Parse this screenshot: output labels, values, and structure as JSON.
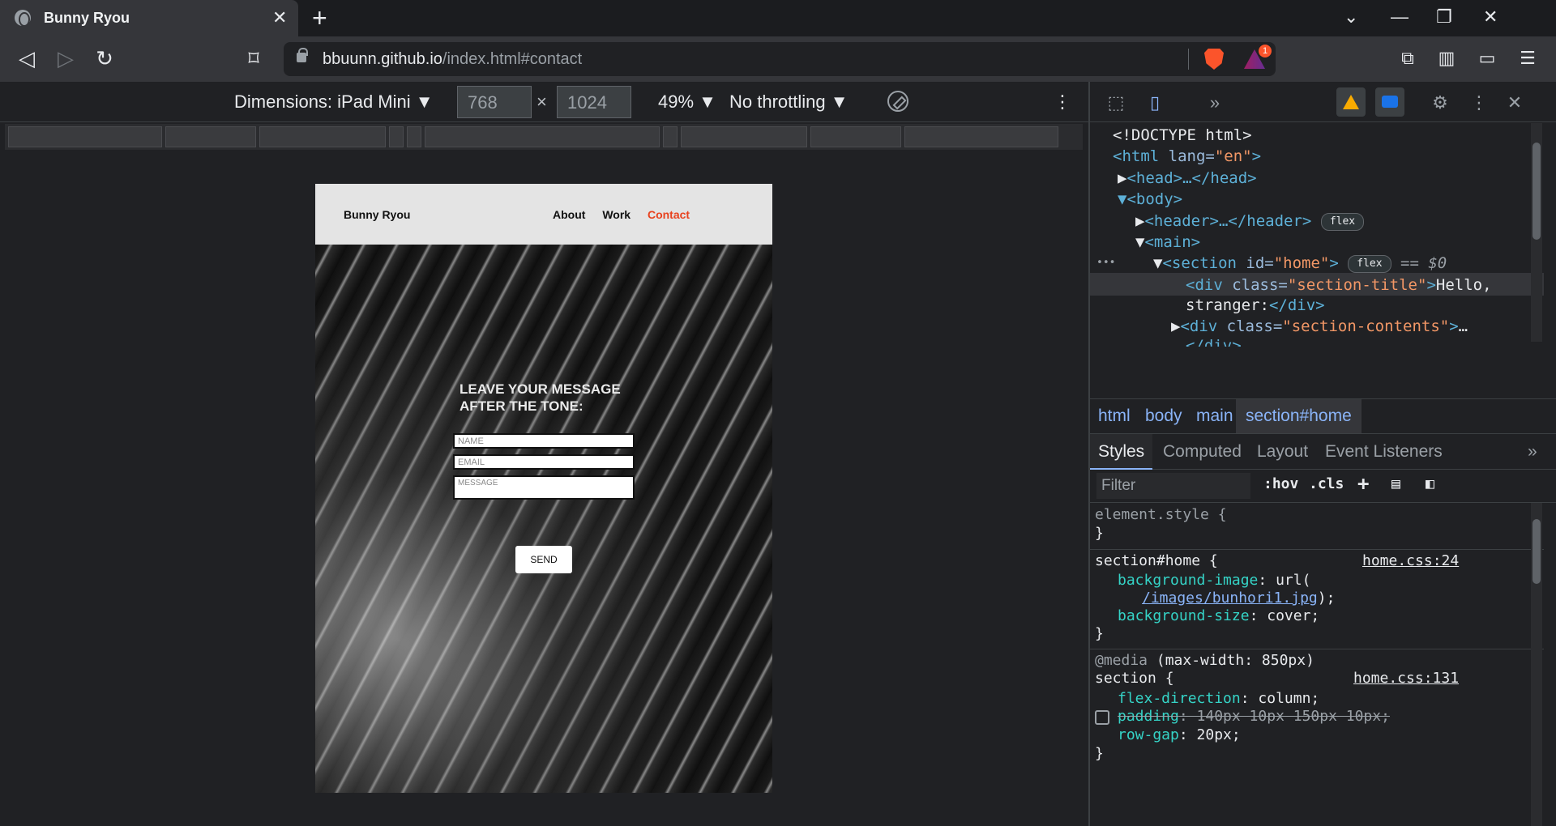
{
  "browser": {
    "tab_title": "Bunny Ryou",
    "tab_close": "✕",
    "new_tab": "+",
    "url_host": "bbuunn.github.io",
    "url_path": "/index.html#contact",
    "bat_badge": "1"
  },
  "device_toolbar": {
    "dimensions_label": "Dimensions: iPad Mini ▼",
    "width": "768",
    "times": "×",
    "height": "1024",
    "zoom": "49% ▼",
    "throttling": "No throttling ▼"
  },
  "site": {
    "logo": "Bunny Ryou",
    "nav": [
      "About",
      "Work",
      "Contact"
    ],
    "hero_title_line1": "LEAVE YOUR MESSAGE",
    "hero_title_line2": "AFTER THE TONE:",
    "name_placeholder": "NAME",
    "email_placeholder": "EMAIL",
    "message_placeholder": "MESSAGE",
    "send_label": "SEND"
  },
  "devtools": {
    "dom": {
      "doctype": "<!DOCTYPE html>",
      "html_open_tag": "<html ",
      "html_attr": "lang=",
      "html_val": "\"en\"",
      "html_close": ">",
      "head": "<head>…</head>",
      "body_open": "<body>",
      "header": "<header>…</header>",
      "flex_pill": "flex",
      "main_open": "<main>",
      "section_tag": "<section ",
      "section_attr": "id=",
      "section_val": "\"home\"",
      "section_close": ">",
      "eq_dollar0": "== $0",
      "div_tag": "<div ",
      "div_attr": "class=",
      "div_val_title": "\"section-title\"",
      "div_text": "Hello,",
      "div_text2": "stranger:",
      "div_close": "</div>",
      "div_val_contents": "\"section-contents\"",
      "ellipsis": "…",
      "div_close_partial": "</div>",
      "dots": "•••"
    },
    "breadcrumbs": [
      "html",
      "body",
      "main",
      "section#home"
    ],
    "tabs": [
      "Styles",
      "Computed",
      "Layout",
      "Event Listeners"
    ],
    "filter_placeholder": "Filter",
    "hov": ":hov",
    "cls": ".cls",
    "styles": {
      "element_style": "element.style {",
      "close_brace": "}",
      "sel1": "section#home {",
      "src1": "home.css:24",
      "prop_bg_image": "background-image",
      "val_bg_image_prefix": ": url(",
      "val_bg_image_url": "/images/bunhori1.jpg",
      "val_bg_image_suffix": ");",
      "prop_bg_size": "background-size",
      "val_bg_size": ": cover;",
      "media": "@media",
      "media_query": " (max-width: 850px)",
      "sel2": "section {",
      "src2": "home.css:131",
      "prop_flex_dir": "flex-direction",
      "val_flex_dir": ": column;",
      "prop_padding": "padding",
      "val_padding": ": 140px 10px 150px 10px;",
      "prop_row_gap": "row-gap",
      "val_row_gap": ": 20px;"
    }
  },
  "colors": {
    "accent_nav": "#e8421e",
    "devtools_bg": "#202124"
  }
}
